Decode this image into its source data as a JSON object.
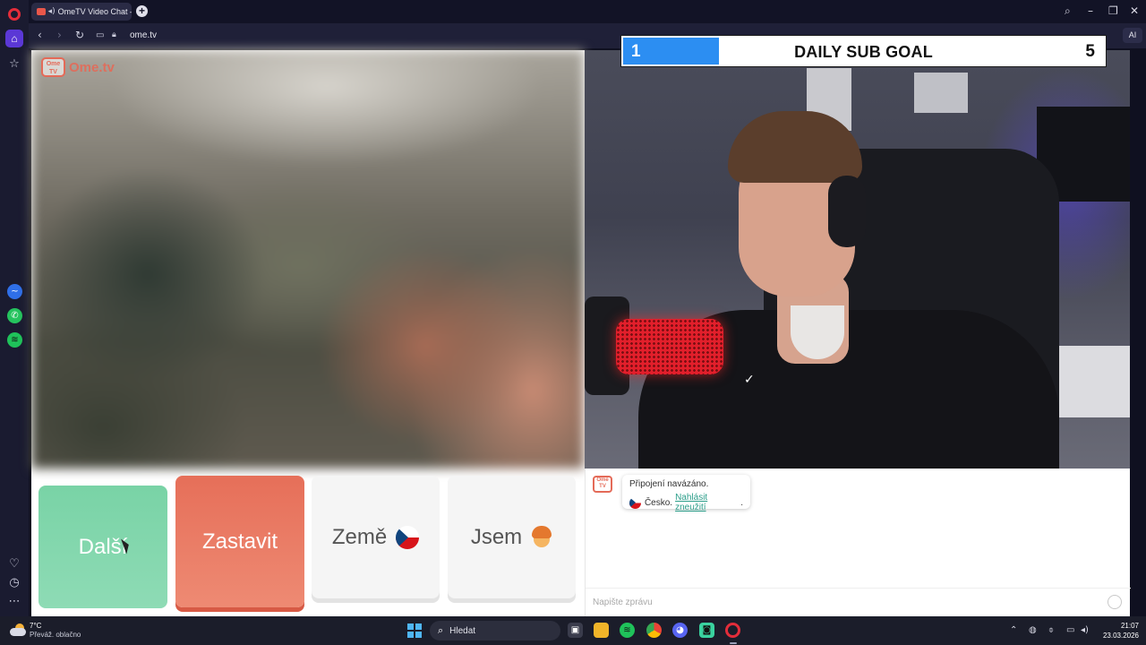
{
  "browser": {
    "tab": {
      "title": "OmeTV Video Chat –",
      "audio_icon": "speaker-icon"
    },
    "address": {
      "url": "ome.tv"
    },
    "ai_label": "AI"
  },
  "overlay": {
    "title": "DAILY SUB GOAL",
    "current": "1",
    "target": "5",
    "progress_fraction": 0.2,
    "fill_color": "#2c8ef2"
  },
  "site": {
    "logo_text": "Ome.tv",
    "logo_badge": "Ome TV",
    "brand_color": "#e46a58"
  },
  "controls": {
    "next_label": "Další",
    "stop_label": "Zastavit",
    "country_label": "Země",
    "iam_label": "Jsem",
    "next_color": "#79d3a6",
    "stop_color": "#e66f59"
  },
  "chat": {
    "status_line": "Připojení navázáno.",
    "country": "Česko.",
    "report_link": "Nahlásit zneužití",
    "report_suffix": ".",
    "input_placeholder": "Napište zprávu"
  },
  "taskbar": {
    "weather_temp": "7°C",
    "weather_desc": "Převáž. oblačno",
    "search_label": "Hledat",
    "time": "21:07",
    "date": "23.03.2026"
  }
}
